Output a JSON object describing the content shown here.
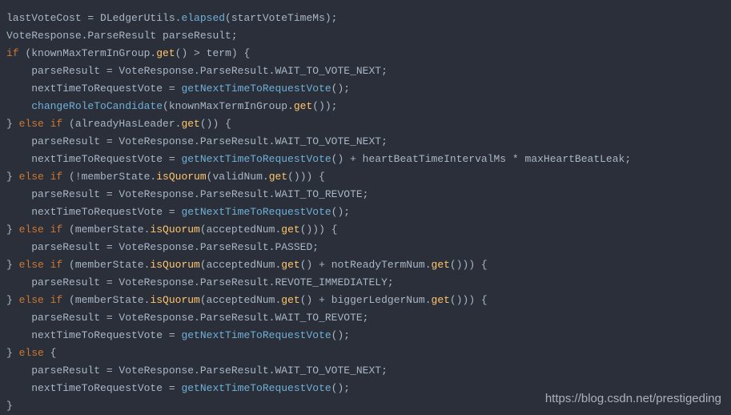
{
  "code": {
    "l1_a": "lastVoteCost = DLedgerUtils.",
    "l1_b": "elapsed",
    "l1_c": "(startVoteTimeMs);",
    "l2": "VoteResponse.ParseResult parseResult;",
    "l3_a": "if",
    "l3_b": " (knownMaxTermInGroup.",
    "l3_c": "get",
    "l3_d": "() > term) {",
    "l4": "    parseResult = VoteResponse.ParseResult.WAIT_TO_VOTE_NEXT;",
    "l5_a": "    nextTimeToRequestVote = ",
    "l5_b": "getNextTimeToRequestVote",
    "l5_c": "();",
    "l6_a": "    ",
    "l6_b": "changeRoleToCandidate",
    "l6_c": "(knownMaxTermInGroup.",
    "l6_d": "get",
    "l6_e": "());",
    "l7_a": "} ",
    "l7_b": "else if",
    "l7_c": " (alreadyHasLeader.",
    "l7_d": "get",
    "l7_e": "()) {",
    "l8": "    parseResult = VoteResponse.ParseResult.WAIT_TO_VOTE_NEXT;",
    "l9_a": "    nextTimeToRequestVote = ",
    "l9_b": "getNextTimeToRequestVote",
    "l9_c": "() + heartBeatTimeIntervalMs * maxHeartBeatLeak;",
    "l10_a": "} ",
    "l10_b": "else if",
    "l10_c": " (!memberState.",
    "l10_d": "isQuorum",
    "l10_e": "(validNum.",
    "l10_f": "get",
    "l10_g": "())) {",
    "l11": "    parseResult = VoteResponse.ParseResult.WAIT_TO_REVOTE;",
    "l12_a": "    nextTimeToRequestVote = ",
    "l12_b": "getNextTimeToRequestVote",
    "l12_c": "();",
    "l13_a": "} ",
    "l13_b": "else if",
    "l13_c": " (memberState.",
    "l13_d": "isQuorum",
    "l13_e": "(acceptedNum.",
    "l13_f": "get",
    "l13_g": "())) {",
    "l14": "    parseResult = VoteResponse.ParseResult.PASSED;",
    "l15_a": "} ",
    "l15_b": "else if",
    "l15_c": " (memberState.",
    "l15_d": "isQuorum",
    "l15_e": "(acceptedNum.",
    "l15_f": "get",
    "l15_g": "() + notReadyTermNum.",
    "l15_h": "get",
    "l15_i": "())) {",
    "l16": "    parseResult = VoteResponse.ParseResult.REVOTE_IMMEDIATELY;",
    "l17_a": "} ",
    "l17_b": "else if",
    "l17_c": " (memberState.",
    "l17_d": "isQuorum",
    "l17_e": "(acceptedNum.",
    "l17_f": "get",
    "l17_g": "() + biggerLedgerNum.",
    "l17_h": "get",
    "l17_i": "())) {",
    "l18": "    parseResult = VoteResponse.ParseResult.WAIT_TO_REVOTE;",
    "l19_a": "    nextTimeToRequestVote = ",
    "l19_b": "getNextTimeToRequestVote",
    "l19_c": "();",
    "l20_a": "} ",
    "l20_b": "else",
    "l20_c": " {",
    "l21": "    parseResult = VoteResponse.ParseResult.WAIT_TO_VOTE_NEXT;",
    "l22_a": "    nextTimeToRequestVote = ",
    "l22_b": "getNextTimeToRequestVote",
    "l22_c": "();",
    "l23": "}"
  },
  "watermark": "https://blog.csdn.net/prestigeding"
}
